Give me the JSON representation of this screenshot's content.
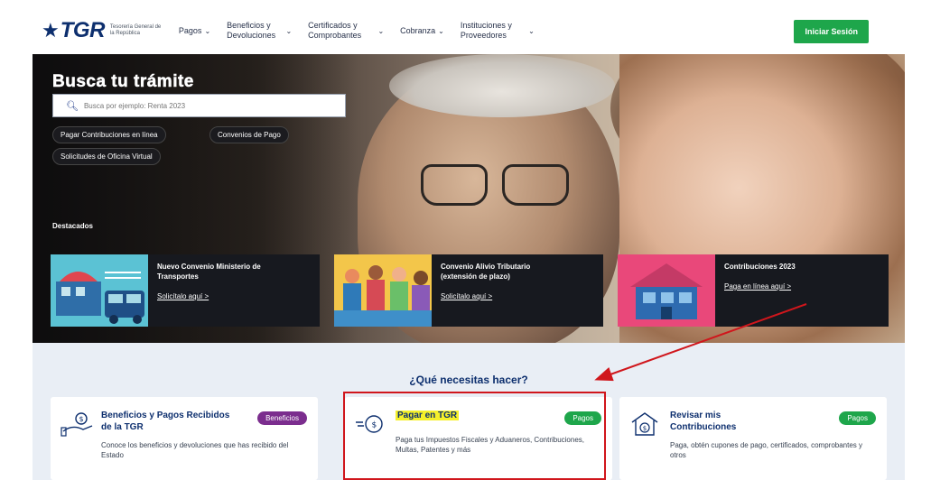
{
  "header": {
    "logo_text": "TGR",
    "logo_sub": "Tesorería General de la República",
    "nav": [
      {
        "label": "Pagos",
        "icon": "chevron-down-icon"
      },
      {
        "label": "Beneficios y Devoluciones",
        "icon": "chevron-down-icon"
      },
      {
        "label": "Certificados y Comprobantes",
        "icon": "chevron-down-icon"
      },
      {
        "label": "Cobranza",
        "icon": "chevron-down-icon"
      },
      {
        "label": "Instituciones y Proveedores",
        "icon": "chevron-down-icon"
      }
    ],
    "login_label": "Iniciar Sesión"
  },
  "hero": {
    "title": "Busca tu trámite",
    "search_placeholder": "Busca por ejemplo: Renta 2023",
    "pills": [
      "Pagar Contribuciones en línea",
      "Convenios de Pago",
      "Solicitudes de Oficina Virtual"
    ],
    "destacados_label": "Destacados",
    "featured": [
      {
        "title": "Nuevo Convenio Ministerio de Transportes",
        "link": "Solicítalo aquí >"
      },
      {
        "title": "Convenio Alivio Tributario (extensión de plazo)",
        "link": "Solicítalo aquí >"
      },
      {
        "title": "Contribuciones 2023",
        "link": "Paga en línea aquí >"
      }
    ]
  },
  "services": {
    "question": "¿Qué necesitas hacer?",
    "cards": [
      {
        "title": "Beneficios y Pagos Recibidos de la TGR",
        "desc": "Conoce los beneficios y devoluciones que has recibido del Estado",
        "badge": "Beneficios",
        "badge_color": "#7b2d8e",
        "icon": "hand-coin-icon"
      },
      {
        "title": "Pagar en TGR",
        "desc": "Paga tus Impuestos Fiscales y Aduaneros, Contribuciones, Multas, Patentes y más",
        "badge": "Pagos",
        "badge_color": "#1ea64b",
        "icon": "payment-icon"
      },
      {
        "title": "Revisar mis Contribuciones",
        "desc": "Paga, obtén cupones de pago, certificados, comprobantes y otros",
        "badge": "Pagos",
        "badge_color": "#1ea64b",
        "icon": "house-coin-icon"
      }
    ]
  },
  "colors": {
    "brand": "#0d2f6e",
    "accent_green": "#1ea64b",
    "annotation_red": "#d0161c",
    "highlight_yellow": "#f5f02a"
  }
}
